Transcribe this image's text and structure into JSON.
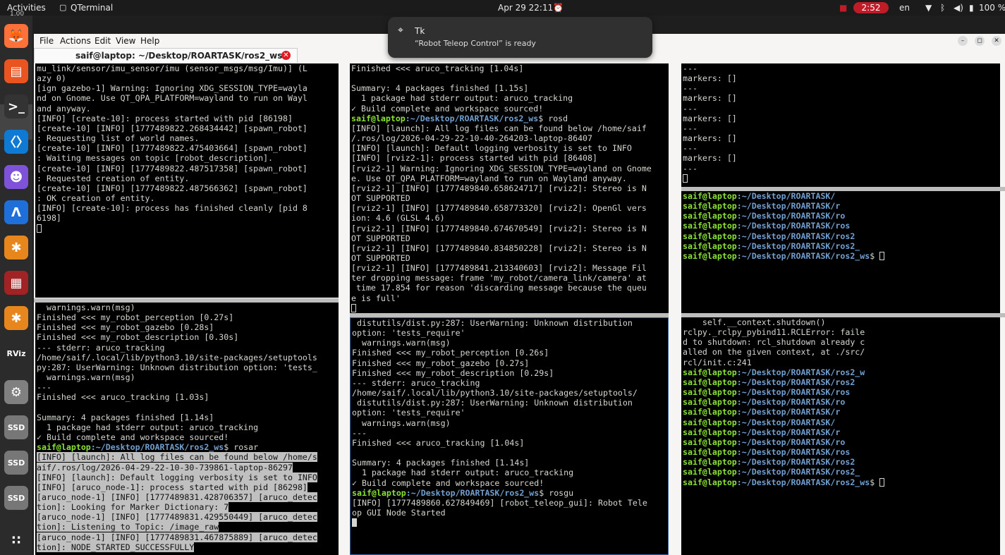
{
  "topbar": {
    "activities": "Activities",
    "app_name": "QTerminal",
    "datetime": "Apr 29  22:11",
    "recording_time": "2:52",
    "language": "en",
    "battery": "100 %",
    "icons": [
      "alarm-icon",
      "stop-icon",
      "wifi-icon",
      "bluetooth-icon",
      "volume-icon",
      "battery-icon",
      "power-icon"
    ]
  },
  "dock": {
    "zoom": "1.00",
    "items": [
      {
        "name": "firefox",
        "glyph": "🦊",
        "color": "#ff7139"
      },
      {
        "name": "files",
        "glyph": "▤",
        "color": "#e95420"
      },
      {
        "name": "terminal",
        "glyph": ">_",
        "color": "#333333"
      },
      {
        "name": "vscode",
        "glyph": "〈〉",
        "color": "#0e7ad4"
      },
      {
        "name": "ghost",
        "glyph": "☻",
        "color": "#7e52d9"
      },
      {
        "name": "arduino",
        "glyph": "Ʌ",
        "color": "#1e6fd9"
      },
      {
        "name": "ros",
        "glyph": "✱",
        "color": "#e8861e"
      },
      {
        "name": "monitor",
        "glyph": "▦",
        "color": "#a12323"
      },
      {
        "name": "ros2",
        "glyph": "✱",
        "color": "#e8861e"
      },
      {
        "name": "rviz",
        "glyph": "RViz",
        "color": "#2b2b2b"
      },
      {
        "name": "settings",
        "glyph": "⚙",
        "color": "#808080"
      },
      {
        "name": "ssd1",
        "glyph": "SSD",
        "color": "#777777"
      },
      {
        "name": "ssd2",
        "glyph": "SSD",
        "color": "#777777"
      },
      {
        "name": "ssd3",
        "glyph": "SSD",
        "color": "#777777"
      },
      {
        "name": "apps",
        "glyph": "∷",
        "color": "#2b2b2b"
      }
    ]
  },
  "menu": {
    "file": "File",
    "actions": "Actions",
    "edit": "Edit",
    "view": "View",
    "help": "Help"
  },
  "tab": {
    "title": "saif@laptop: ~/Desktop/ROARTASK/ros2_ws",
    "close": "✕"
  },
  "notification": {
    "app": "Tk",
    "message": "“Robot Teleop Control” is ready"
  },
  "panes": {
    "top_left": [
      {
        "t": "mu_link/sensor/imu_sensor/imu (sensor_msgs/msg/Imu)] (L"
      },
      {
        "t": "azy 0)"
      },
      {
        "t": "[ign gazebo-1] Warning: Ignoring XDG_SESSION_TYPE=wayla"
      },
      {
        "t": "nd on Gnome. Use QT_QPA_PLATFORM=wayland to run on Wayl"
      },
      {
        "t": "and anyway."
      },
      {
        "t": "[INFO] [create-10]: process started with pid [86198]"
      },
      {
        "t": "[create-10] [INFO] [1777489822.268434442] [spawn_robot]"
      },
      {
        "t": ": Requesting list of world names."
      },
      {
        "t": "[create-10] [INFO] [1777489822.475403664] [spawn_robot]"
      },
      {
        "t": ": Waiting messages on topic [robot_description]."
      },
      {
        "t": "[create-10] [INFO] [1777489822.487517358] [spawn_robot]"
      },
      {
        "t": ": Requested creation of entity."
      },
      {
        "t": "[create-10] [INFO] [1777489822.487566362] [spawn_robot]"
      },
      {
        "t": ": OK creation of entity."
      },
      {
        "t": "[INFO] [create-10]: process has finished cleanly [pid 8"
      },
      {
        "t": "6198]"
      },
      {
        "t": "",
        "cursor": "box"
      }
    ],
    "bottom_left": [
      {
        "t": "  warnings.warn(msg)"
      },
      {
        "t": "Finished <<< my_robot_perception [0.27s]"
      },
      {
        "t": "Finished <<< my_robot_gazebo [0.28s]"
      },
      {
        "t": "Finished <<< my_robot_description [0.30s]"
      },
      {
        "t": "--- stderr: aruco_tracking"
      },
      {
        "t": "/home/saif/.local/lib/python3.10/site-packages/setuptools"
      },
      {
        "t": "py:287: UserWarning: Unknown distribution option: 'tests_"
      },
      {
        "t": "  warnings.warn(msg)"
      },
      {
        "t": "---"
      },
      {
        "t": "Finished <<< aruco_tracking [1.03s]"
      },
      {
        "t": ""
      },
      {
        "t": "Summary: 4 packages finished [1.14s]"
      },
      {
        "t": "  1 package had stderr output: aruco_tracking"
      },
      {
        "t": "✓ Build complete and workspace sourced!"
      },
      {
        "user": "saif@laptop",
        "path": ":~/Desktop/ROARTASK/ros2_ws",
        "cmd": "$ rosar"
      },
      {
        "t": "[INFO] [launch]: All log files can be found below /home/s",
        "sel": true
      },
      {
        "t": "aif/.ros/log/2026-04-29-22-10-30-739861-laptop-86297",
        "sel": true
      },
      {
        "t": "[INFO] [launch]: Default logging verbosity is set to INFO",
        "sel": true
      },
      {
        "t": "[INFO] [aruco_node-1]: process started with pid [86298]",
        "sel": true
      },
      {
        "t": "[aruco_node-1] [INFO] [1777489831.428706357] [aruco_detec",
        "sel": true
      },
      {
        "t": "tion]: Looking for Marker Dictionary: 7",
        "sel": true
      },
      {
        "t": "[aruco_node-1] [INFO] [1777489831.429550449] [aruco_detec",
        "sel": true
      },
      {
        "t": "tion]: Listening to Topic: /image_raw",
        "sel": true
      },
      {
        "t": "[aruco_node-1] [INFO] [1777489831.467875889] [aruco_detec",
        "sel": true
      },
      {
        "t": "tion]: NODE_STARTED_SUCCESSFULLY",
        "sel": true
      }
    ],
    "top_middle": [
      {
        "t": "Finished <<< aruco_tracking [1.04s]"
      },
      {
        "t": ""
      },
      {
        "t": "Summary: 4 packages finished [1.15s]"
      },
      {
        "t": "  1 package had stderr output: aruco_tracking"
      },
      {
        "t": "✓ Build complete and workspace sourced!"
      },
      {
        "user": "saif@laptop",
        "path": ":~/Desktop/ROARTASK/ros2_ws",
        "cmd": "$ rosd"
      },
      {
        "t": "[INFO] [launch]: All log files can be found below /home/saif"
      },
      {
        "t": "/.ros/log/2026-04-29-22-10-40-264203-laptop-86407"
      },
      {
        "t": "[INFO] [launch]: Default logging verbosity is set to INFO"
      },
      {
        "t": "[INFO] [rviz2-1]: process started with pid [86408]"
      },
      {
        "t": "[rviz2-1] Warning: Ignoring XDG_SESSION_TYPE=wayland on Gnome"
      },
      {
        "t": "e. Use QT_QPA_PLATFORM=wayland to run on Wayland anyway."
      },
      {
        "t": "[rviz2-1] [INFO] [1777489840.658624717] [rviz2]: Stereo is N"
      },
      {
        "t": "OT SUPPORTED"
      },
      {
        "t": "[rviz2-1] [INFO] [1777489840.658773320] [rviz2]: OpenGl vers"
      },
      {
        "t": "ion: 4.6 (GLSL 4.6)"
      },
      {
        "t": "[rviz2-1] [INFO] [1777489840.674670549] [rviz2]: Stereo is N"
      },
      {
        "t": "OT SUPPORTED"
      },
      {
        "t": "[rviz2-1] [INFO] [1777489840.834850228] [rviz2]: Stereo is N"
      },
      {
        "t": "OT SUPPORTED"
      },
      {
        "t": "[rviz2-1] [INFO] [1777489841.213340603] [rviz2]: Message Fil"
      },
      {
        "t": "ter dropping message: frame 'my_robot/camera_link/camera' at"
      },
      {
        "t": " time 17.854 for reason 'discarding message because the queu"
      },
      {
        "t": "e is full'"
      },
      {
        "t": "",
        "cursor": "box"
      }
    ],
    "bottom_middle": [
      {
        "t": " distutils/dist.py:287: UserWarning: Unknown distribution"
      },
      {
        "t": "option: 'tests_require'"
      },
      {
        "t": "  warnings.warn(msg)"
      },
      {
        "t": "Finished <<< my_robot_perception [0.26s]"
      },
      {
        "t": "Finished <<< my_robot_gazebo [0.27s]"
      },
      {
        "t": "Finished <<< my_robot_description [0.29s]"
      },
      {
        "t": "--- stderr: aruco_tracking"
      },
      {
        "t": "/home/saif/.local/lib/python3.10/site-packages/setuptools/"
      },
      {
        "t": " distutils/dist.py:287: UserWarning: Unknown distribution"
      },
      {
        "t": "option: 'tests_require'"
      },
      {
        "t": "  warnings.warn(msg)"
      },
      {
        "t": "---"
      },
      {
        "t": "Finished <<< aruco_tracking [1.04s]"
      },
      {
        "t": ""
      },
      {
        "t": "Summary: 4 packages finished [1.14s]"
      },
      {
        "t": "  1 package had stderr output: aruco_tracking"
      },
      {
        "t": "✓ Build complete and workspace sourced!"
      },
      {
        "user": "saif@laptop",
        "path": ":~/Desktop/ROARTASK/ros2_ws",
        "cmd": "$ rosgu"
      },
      {
        "t": "[INFO] [1777489860.627849469] [robot_teleop_gui]: Robot Tele"
      },
      {
        "t": "op GUI Node Started"
      },
      {
        "t": "",
        "cursor": "fill"
      }
    ],
    "top_right": [
      {
        "t": "---"
      },
      {
        "t": "markers: []"
      },
      {
        "t": "---"
      },
      {
        "t": "markers: []"
      },
      {
        "t": "---"
      },
      {
        "t": "markers: []"
      },
      {
        "t": "---"
      },
      {
        "t": "markers: []"
      },
      {
        "t": "---"
      },
      {
        "t": "markers: []"
      },
      {
        "t": "---"
      },
      {
        "t": "",
        "cursor": "box"
      }
    ],
    "middle_right": [
      {
        "user": "saif@laptop",
        "path": ":~/Desktop/ROARTASK/",
        "cmd": ""
      },
      {
        "user": "saif@laptop",
        "path": ":~/Desktop/ROARTASK/r",
        "cmd": ""
      },
      {
        "user": "saif@laptop",
        "path": ":~/Desktop/ROARTASK/ro",
        "cmd": ""
      },
      {
        "user": "saif@laptop",
        "path": ":~/Desktop/ROARTASK/ros",
        "cmd": ""
      },
      {
        "user": "saif@laptop",
        "path": ":~/Desktop/ROARTASK/ros2",
        "cmd": ""
      },
      {
        "user": "saif@laptop",
        "path": ":~/Desktop/ROARTASK/ros2_",
        "cmd": ""
      },
      {
        "user": "saif@laptop",
        "path": ":~/Desktop/ROARTASK/ros2_ws",
        "cmd": "$ ",
        "cursor": "box"
      }
    ],
    "bottom_right": [
      {
        "t": "    self.__context.shutdown()"
      },
      {
        "t": "rclpy._rclpy_pybind11.RCLError: faile"
      },
      {
        "t": "d to shutdown: rcl_shutdown already c"
      },
      {
        "t": "alled on the given context, at ./src/"
      },
      {
        "t": "rcl/init.c:241"
      },
      {
        "user": "saif@laptop",
        "path": ":~/Desktop/ROARTASK/ros2_w",
        "cmd": ""
      },
      {
        "user": "saif@laptop",
        "path": ":~/Desktop/ROARTASK/ros2",
        "cmd": ""
      },
      {
        "user": "saif@laptop",
        "path": ":~/Desktop/ROARTASK/ros",
        "cmd": ""
      },
      {
        "user": "saif@laptop",
        "path": ":~/Desktop/ROARTASK/ro",
        "cmd": ""
      },
      {
        "user": "saif@laptop",
        "path": ":~/Desktop/ROARTASK/r",
        "cmd": ""
      },
      {
        "user": "saif@laptop",
        "path": ":~/Desktop/ROARTASK/",
        "cmd": ""
      },
      {
        "user": "saif@laptop",
        "path": ":~/Desktop/ROARTASK/r",
        "cmd": ""
      },
      {
        "user": "saif@laptop",
        "path": ":~/Desktop/ROARTASK/ro",
        "cmd": ""
      },
      {
        "user": "saif@laptop",
        "path": ":~/Desktop/ROARTASK/ros",
        "cmd": ""
      },
      {
        "user": "saif@laptop",
        "path": ":~/Desktop/ROARTASK/ros2",
        "cmd": ""
      },
      {
        "user": "saif@laptop",
        "path": ":~/Desktop/ROARTASK/ros2_",
        "cmd": ""
      },
      {
        "user": "saif@laptop",
        "path": ":~/Desktop/ROARTASK/ros2_ws",
        "cmd": "$ ",
        "cursor": "box"
      }
    ]
  }
}
